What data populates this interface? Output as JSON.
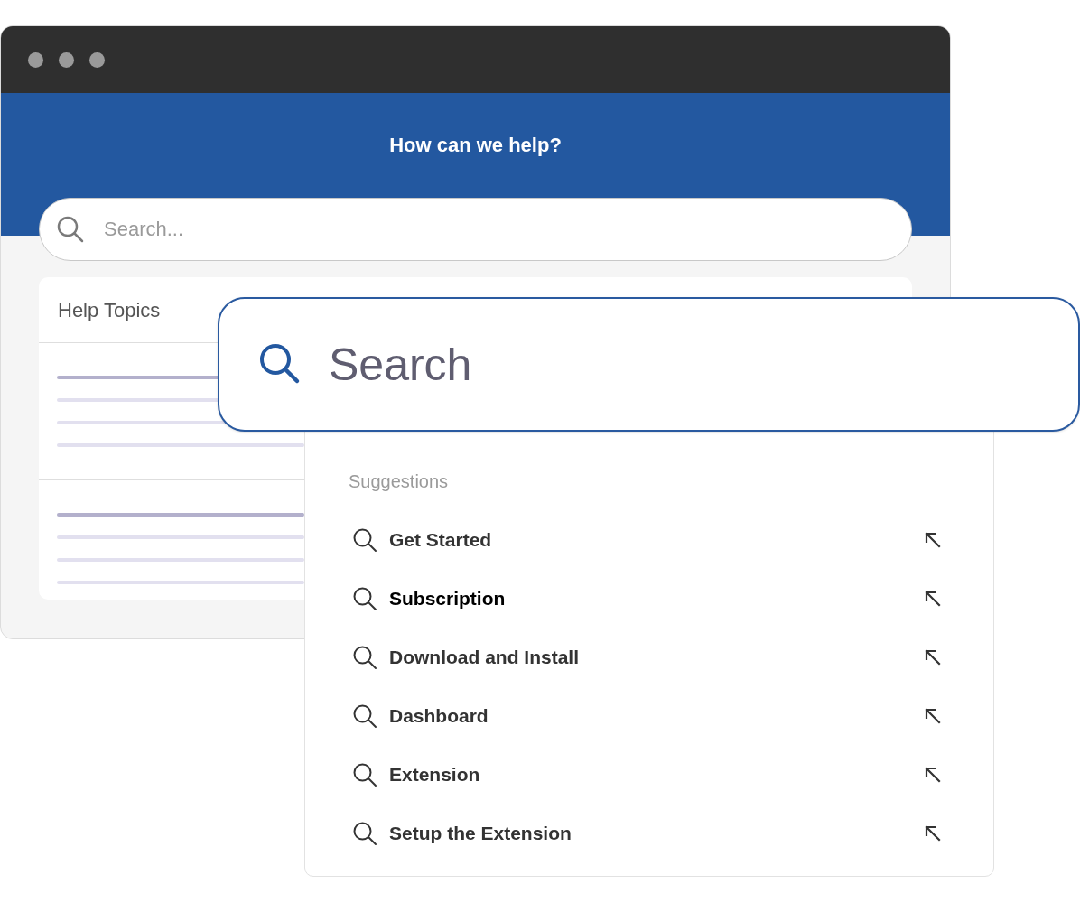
{
  "browser_window": {
    "header": {
      "title": "How can we help?"
    },
    "search": {
      "placeholder": "Search..."
    },
    "help_topics": {
      "title": "Help Topics",
      "groups": [
        {
          "kind": "skeleton"
        },
        {
          "kind": "skeleton"
        }
      ]
    }
  },
  "search_overlay": {
    "placeholder": "Search"
  },
  "suggestions": {
    "heading": "Suggestions",
    "items": [
      {
        "label": "Get Started",
        "selected": false
      },
      {
        "label": "Subscription",
        "selected": true
      },
      {
        "label": "Download and Install",
        "selected": false
      },
      {
        "label": "Dashboard",
        "selected": false
      },
      {
        "label": "Extension",
        "selected": false
      },
      {
        "label": "Setup the Extension",
        "selected": false
      }
    ]
  }
}
